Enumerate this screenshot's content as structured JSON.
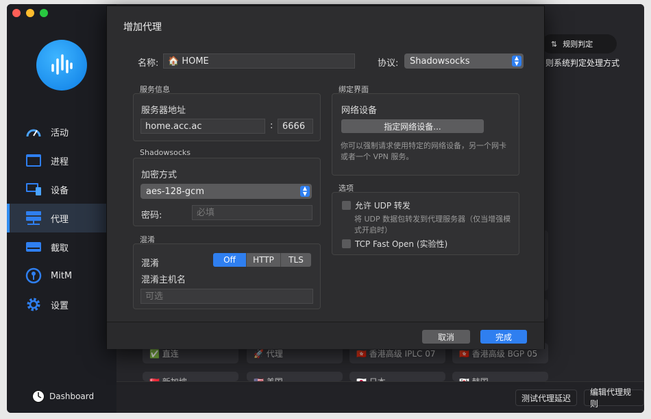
{
  "sidebar": {
    "items": [
      {
        "label": "活动",
        "icon": "gauge-icon"
      },
      {
        "label": "进程",
        "icon": "window-icon"
      },
      {
        "label": "设备",
        "icon": "device-icon"
      },
      {
        "label": "代理",
        "icon": "server-icon"
      },
      {
        "label": "截取",
        "icon": "drive-icon"
      },
      {
        "label": "MitM",
        "icon": "keyhole-icon"
      },
      {
        "label": "设置",
        "icon": "gear-icon"
      }
    ],
    "active": "代理",
    "dashboard": "Dashboard"
  },
  "background": {
    "rule_badge": "规则判定",
    "rule_desc": "则系统判定处理方式",
    "cards_row1": [
      "✅ 直连",
      "🚀 代理",
      "🇭🇰 香港高级 IPLC 07",
      "🇭🇰 香港高级 BGP 05"
    ],
    "cards_row2": [
      "🇸🇬 新加坡",
      "🇺🇸 美国",
      "🇯🇵 日本",
      "🇰🇷 韩国"
    ],
    "test_latency": "测试代理延迟",
    "edit_rules": "编辑代理规则"
  },
  "dialog": {
    "title": "增加代理",
    "name_label": "名称:",
    "name_value": "🏠 HOME",
    "protocol_label": "协议:",
    "protocol_value": "Shadowsocks",
    "server_section": "服务信息",
    "server_address_label": "服务器地址",
    "server_address": "home.acc.ac",
    "port_sep": ":",
    "port": "6666",
    "ss_section": "Shadowsocks",
    "encryption_label": "加密方式",
    "encryption_value": "aes-128-gcm",
    "password_label": "密码:",
    "password_placeholder": "必填",
    "obfs_section": "混淆",
    "obfs_label": "混淆",
    "obfs_options": [
      "Off",
      "HTTP",
      "TLS"
    ],
    "obfs_selected": "Off",
    "obfs_host_label": "混淆主机名",
    "obfs_host_placeholder": "可选",
    "bind_section": "绑定界面",
    "network_device_label": "网络设备",
    "assign_device_button": "指定网络设备...",
    "bind_help": "你可以强制请求使用特定的网络设备，另一个网卡或者一个 VPN 服务。",
    "options_section": "选项",
    "udp_label": "允许 UDP 转发",
    "udp_help": "将 UDP 数据包转发到代理服务器（仅当增强模式开启时）",
    "tfo_label": "TCP Fast Open (实验性)",
    "cancel": "取消",
    "done": "完成"
  },
  "colors": {
    "accent": "#2f7ff0",
    "traffic_red": "#ff5f57",
    "traffic_yellow": "#febc2e",
    "traffic_green": "#28c840"
  }
}
